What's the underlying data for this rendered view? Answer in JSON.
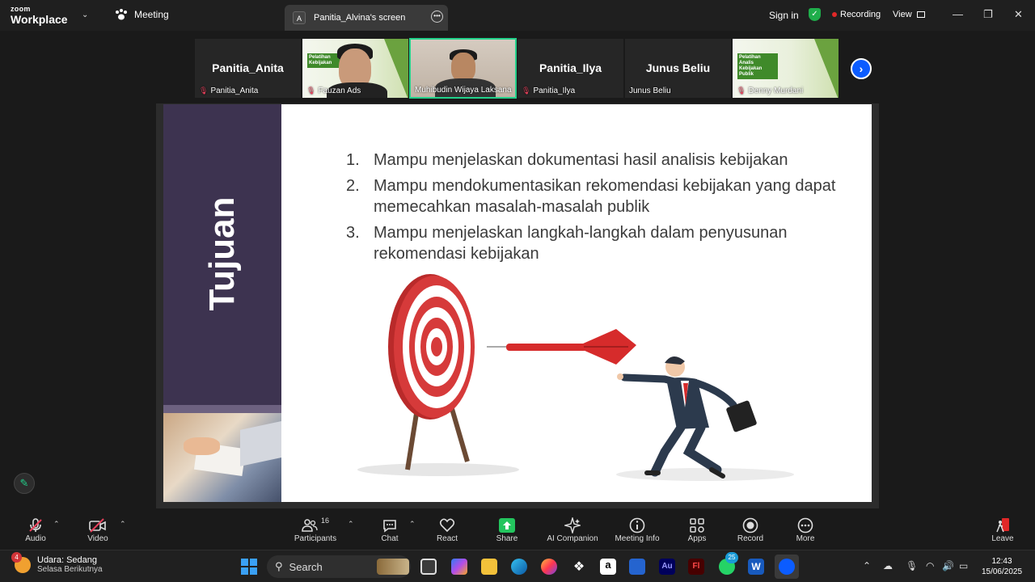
{
  "titlebar": {
    "brand_top": "zoom",
    "brand_bottom": "Workplace",
    "meeting_label": "Meeting",
    "share_tab_initial": "A",
    "share_tab_label": "Panitia_Alvina's screen",
    "sign_in": "Sign in",
    "recording": "Recording",
    "view": "View"
  },
  "participants_strip": [
    {
      "big": "Panitia_Anita",
      "label": "Panitia_Anita",
      "muted": true
    },
    {
      "big": "",
      "label": "Fauzan Ads",
      "muted": true,
      "video": "person",
      "slide_logo": "Pelatihan Kebijakan"
    },
    {
      "big": "",
      "label": "Muhibudin Wijaya Laksana",
      "muted": false,
      "video": "person-room",
      "active": true
    },
    {
      "big": "Panitia_Ilya",
      "label": "Panitia_Ilya",
      "muted": true
    },
    {
      "big": "Junus Beliu",
      "label": "Junus Beliu",
      "muted": false
    },
    {
      "big": "",
      "label": "Denny Murdani",
      "muted": true,
      "slide_logo": "Pelatihan Analis Kebijakan Publik"
    }
  ],
  "slide": {
    "side_title": "Tujuan",
    "items": [
      {
        "num": "1.",
        "text": "Mampu menjelaskan dokumentasi hasil analisis kebijakan"
      },
      {
        "num": "2.",
        "text": "Mampu mendokumentasikan rekomendasi kebijakan yang dapat memecahkan masalah-masalah publik"
      },
      {
        "num": "3.",
        "text": "Mampu menjelaskan langkah-langkah dalam penyusunan rekomendasi kebijakan"
      }
    ]
  },
  "toolbar": {
    "audio": "Audio",
    "video": "Video",
    "participants": "Participants",
    "participants_count": "16",
    "chat": "Chat",
    "react": "React",
    "share": "Share",
    "ai_companion": "AI Companion",
    "meeting_info": "Meeting Info",
    "apps": "Apps",
    "record": "Record",
    "more": "More",
    "leave": "Leave"
  },
  "taskbar": {
    "weather_badge": "4",
    "weather_line1": "Udara: Sedang",
    "weather_line2": "Selasa Berikutnya",
    "search": "Search",
    "whatsapp_badge": "25",
    "time": "12:43",
    "date": "15/06/2025"
  },
  "colors": {
    "sidebar": "#3d3350",
    "accent_green": "#23d18b",
    "zoom_blue": "#0b5cff",
    "muted_red": "#e8415c",
    "dart_red": "#d62b2b"
  }
}
